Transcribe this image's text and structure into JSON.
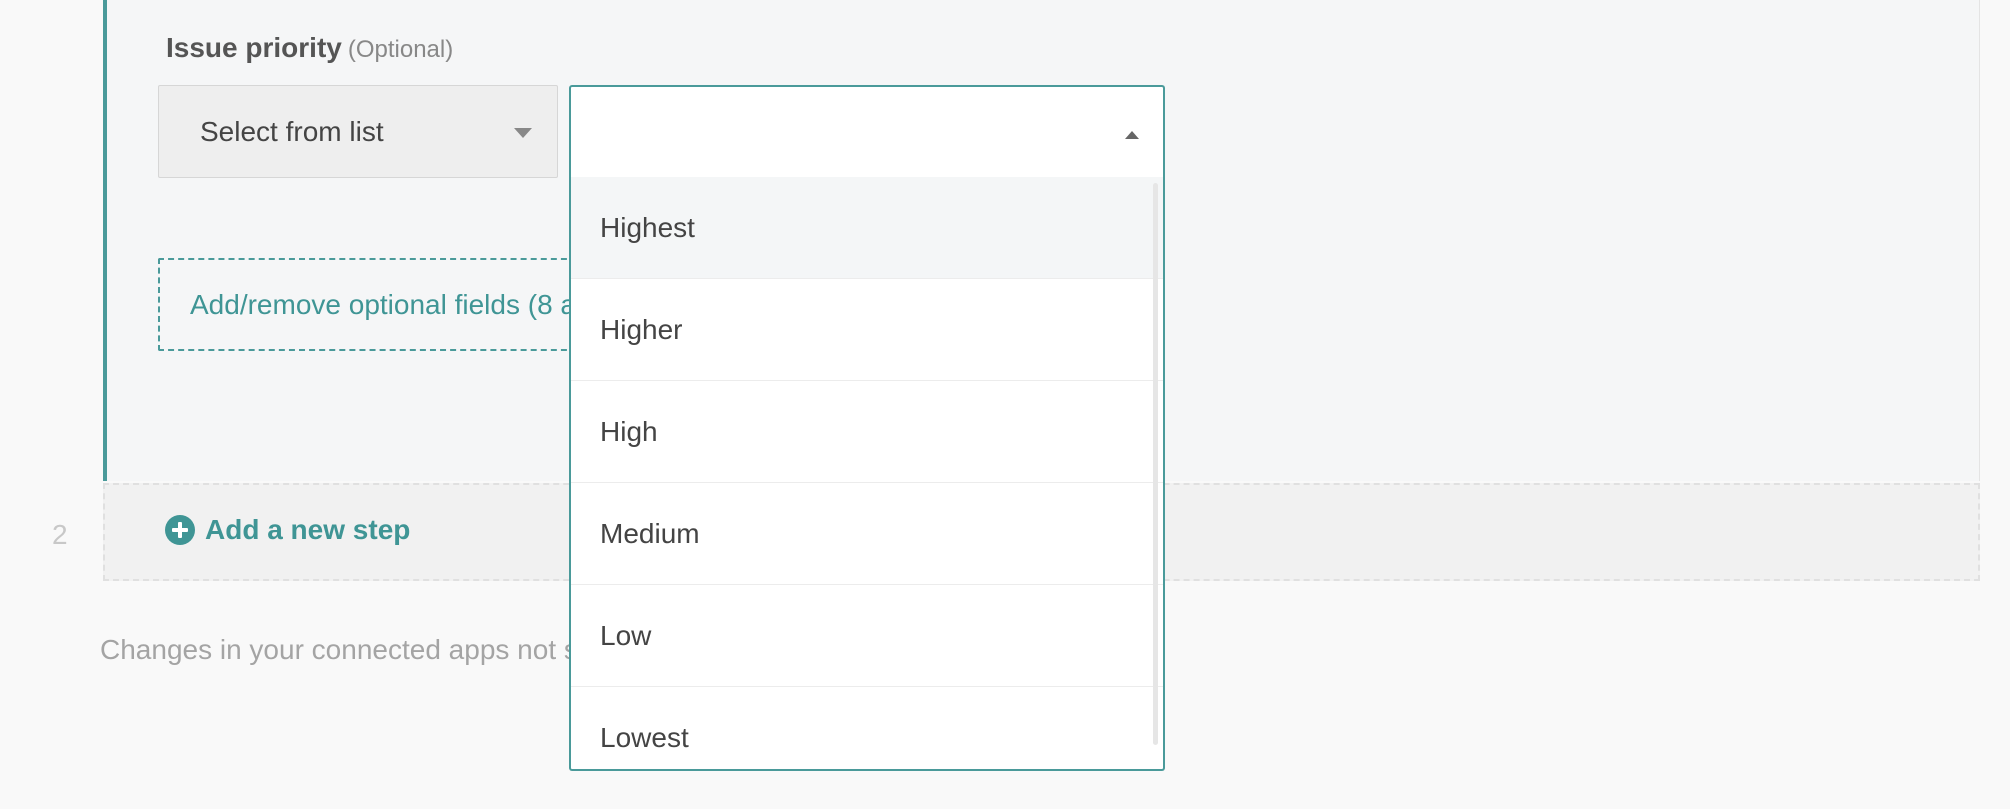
{
  "field": {
    "label": "Issue priority",
    "optional_tag": "(Optional)"
  },
  "mode_select": {
    "value": "Select from list",
    "icon": "caret-down-icon"
  },
  "value_select": {
    "value": "",
    "icon": "caret-up-icon",
    "options": [
      "Highest",
      "Higher",
      "High",
      "Medium",
      "Low",
      "Lowest"
    ],
    "highlighted_index": 0
  },
  "optional_fields": {
    "label": "Add/remove optional fields (8 a"
  },
  "new_step": {
    "number": "2",
    "label": "Add a new step",
    "icon": "plus-circle-icon"
  },
  "footer": {
    "note": "Changes in your connected apps not s"
  },
  "colors": {
    "accent": "#4a9a9a",
    "link": "#3f9595",
    "panel_bg": "#f5f6f7",
    "page_bg": "#f9f9f9"
  }
}
